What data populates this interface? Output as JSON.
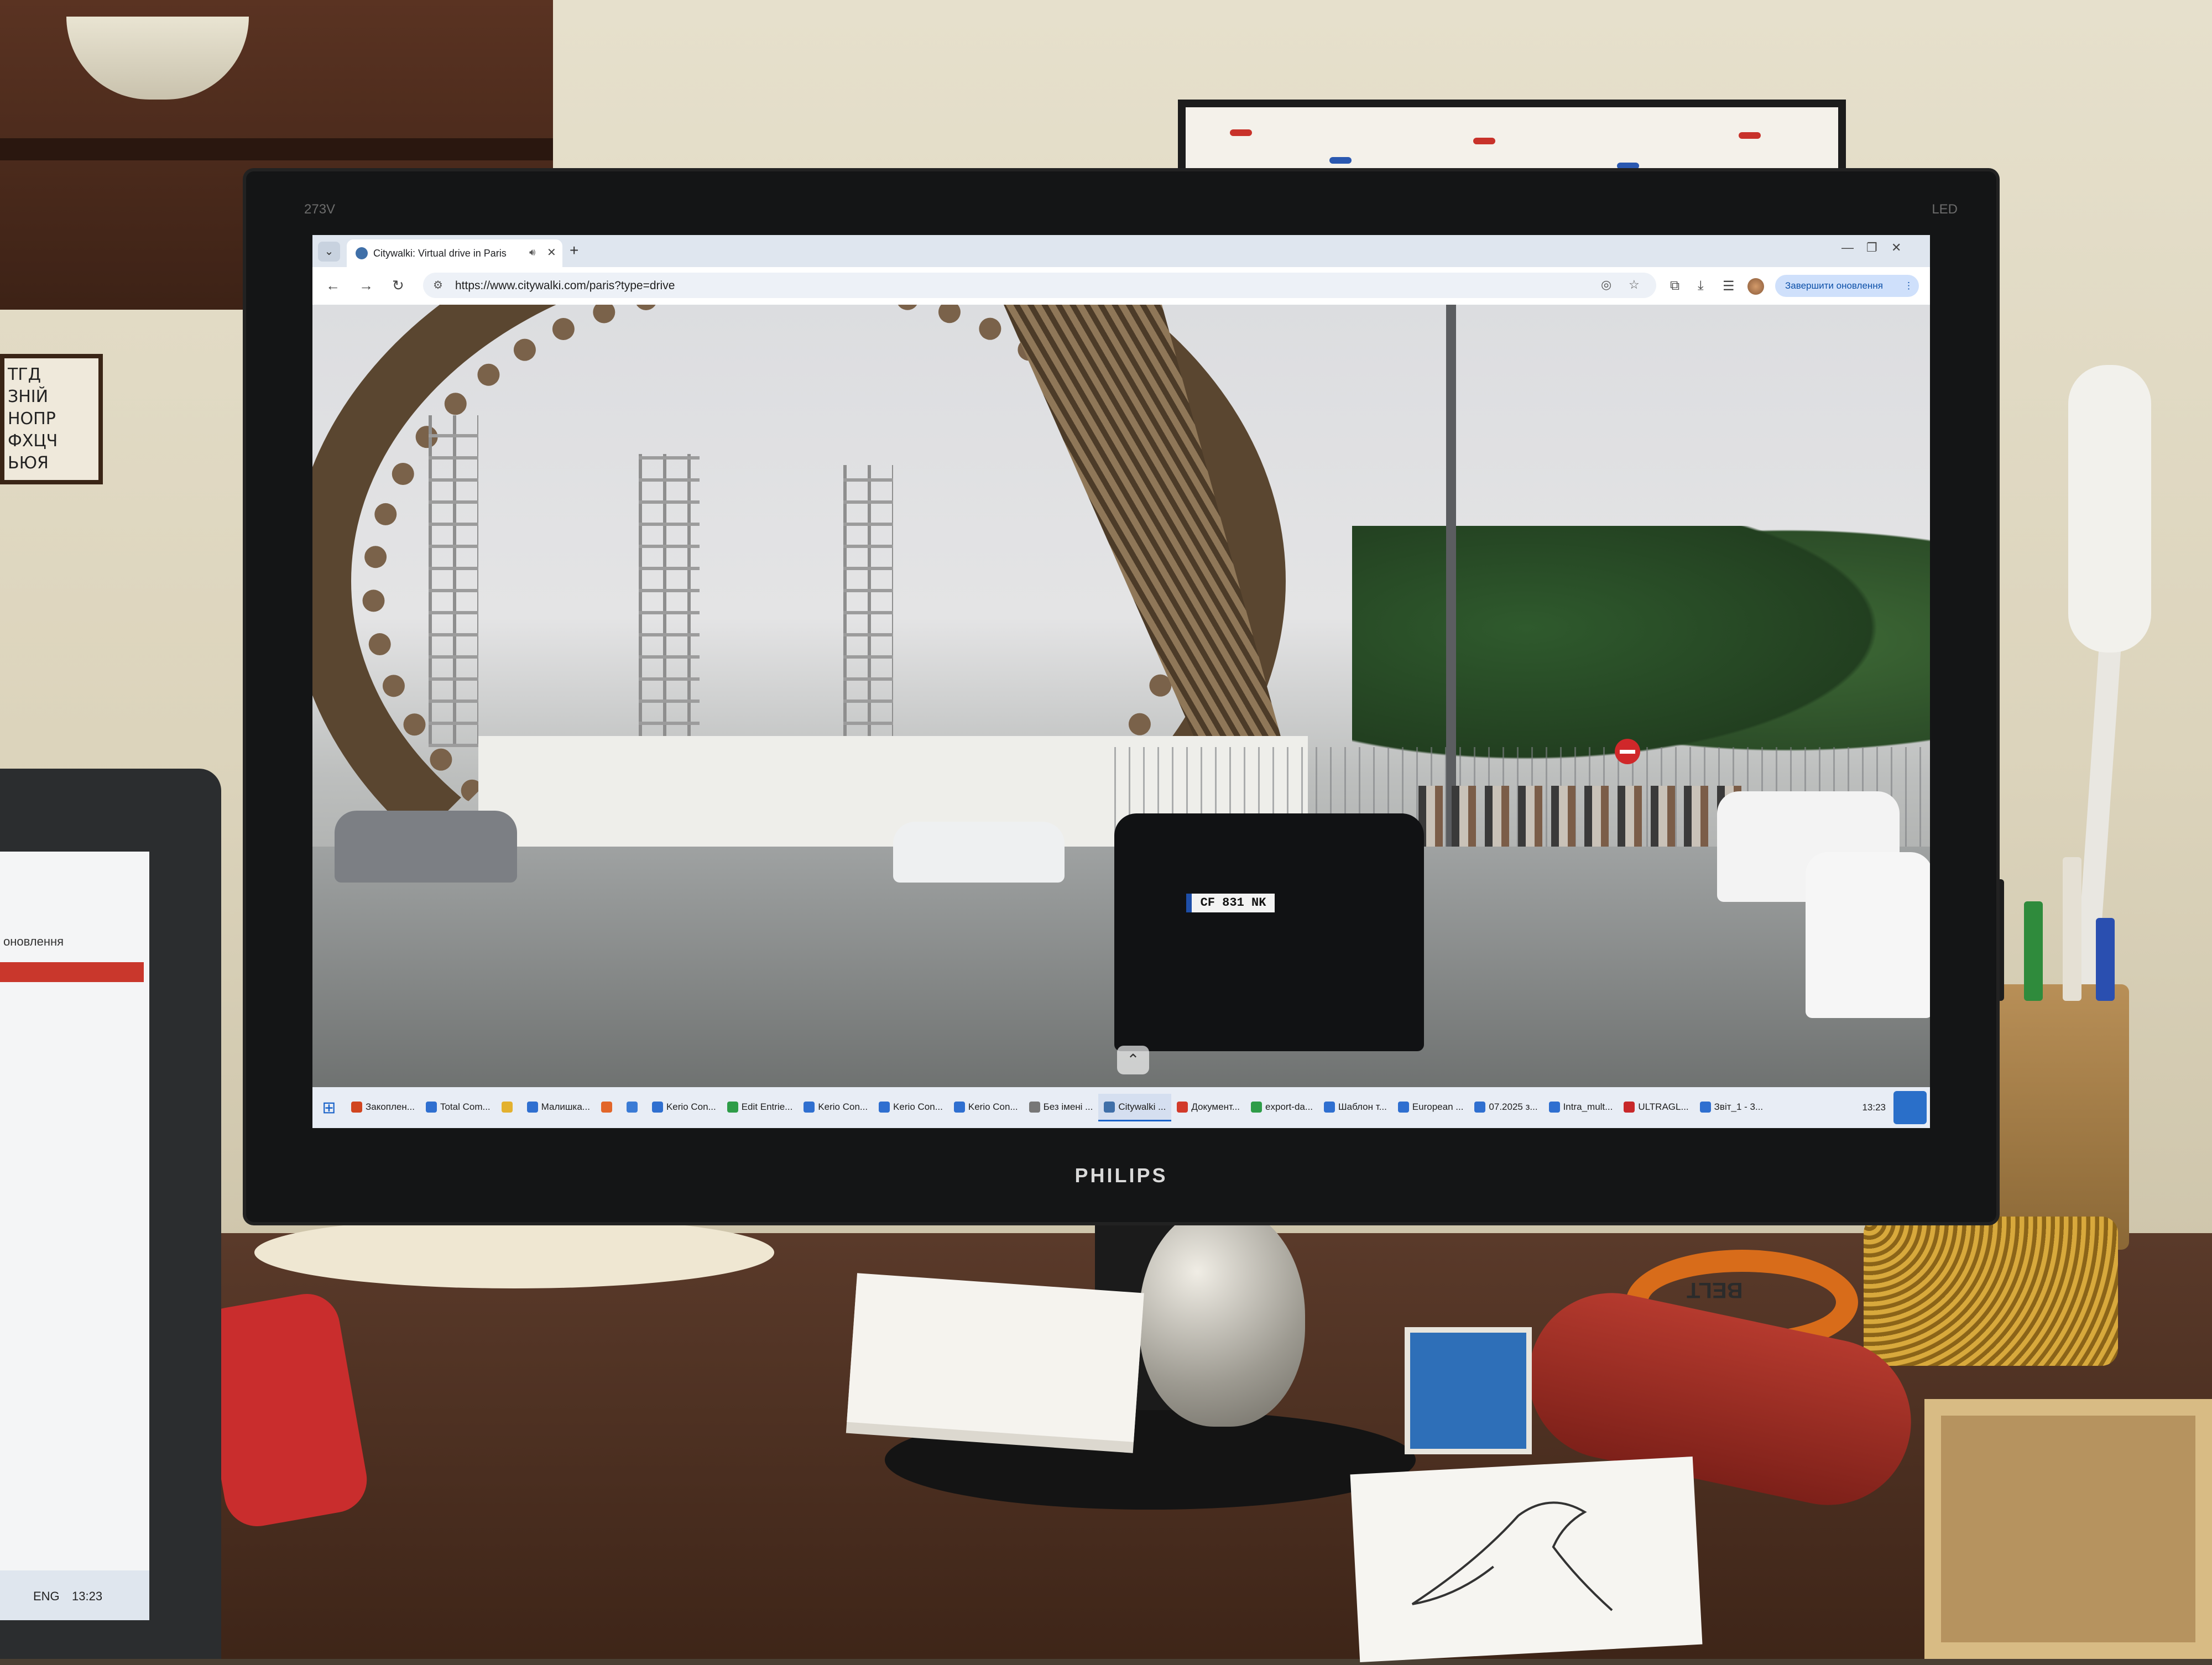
{
  "browser": {
    "tab_title": "Citywalki: Virtual drive in Paris",
    "url": "https://www.citywalki.com/paris?type=drive",
    "update_label": "Завершити оновлення",
    "new_tab_icon": "+",
    "close_icon": "✕"
  },
  "street_view": {
    "license_plate": "CF 831 NK"
  },
  "taskbar": {
    "items": [
      {
        "label": "Закоплен...",
        "color": "#d1451f"
      },
      {
        "label": "Total Com...",
        "color": "#2f6fd0"
      },
      {
        "label": "",
        "color": "#e3b12f"
      },
      {
        "label": "Малишка...",
        "color": "#2f6fd0"
      },
      {
        "label": "",
        "color": "#e2662a"
      },
      {
        "label": "",
        "color": "#3a7bd5"
      },
      {
        "label": "Kerio Con...",
        "color": "#2f6fd0"
      },
      {
        "label": "Edit Entrie...",
        "color": "#2e9c48"
      },
      {
        "label": "Kerio Con...",
        "color": "#2f6fd0"
      },
      {
        "label": "Kerio Con...",
        "color": "#2f6fd0"
      },
      {
        "label": "Kerio Con...",
        "color": "#2f6fd0"
      },
      {
        "label": "Без імені ...",
        "color": "#777777"
      },
      {
        "label": "Citywalki ...",
        "color": "#3f6fa8"
      },
      {
        "label": "Документ...",
        "color": "#d23a2a"
      },
      {
        "label": "export-da...",
        "color": "#2e9c48"
      },
      {
        "label": "Шаблон т...",
        "color": "#2f6fd0"
      },
      {
        "label": "European ...",
        "color": "#2f6fd0"
      },
      {
        "label": "07.2025 з...",
        "color": "#2f6fd0"
      },
      {
        "label": "Intra_mult...",
        "color": "#2f6fd0"
      },
      {
        "label": "ULTRAGL...",
        "color": "#c8282a"
      },
      {
        "label": "Звіт_1 - 3...",
        "color": "#2f6fd0"
      }
    ],
    "active_index": 12,
    "clock": "13:23"
  },
  "monitor": {
    "brand": "PHILIPS",
    "model": "273V",
    "badge": "LED"
  },
  "laptop": {
    "tab_text": "оновлення",
    "language": "ENG",
    "clock": "13:23"
  },
  "desk": {
    "tape_text": "BELT"
  },
  "wall_card": {
    "lines": [
      "ТГД",
      "ЗНІЙ",
      "НОПР",
      "ФХЦЧ",
      "ЬЮЯ"
    ]
  }
}
